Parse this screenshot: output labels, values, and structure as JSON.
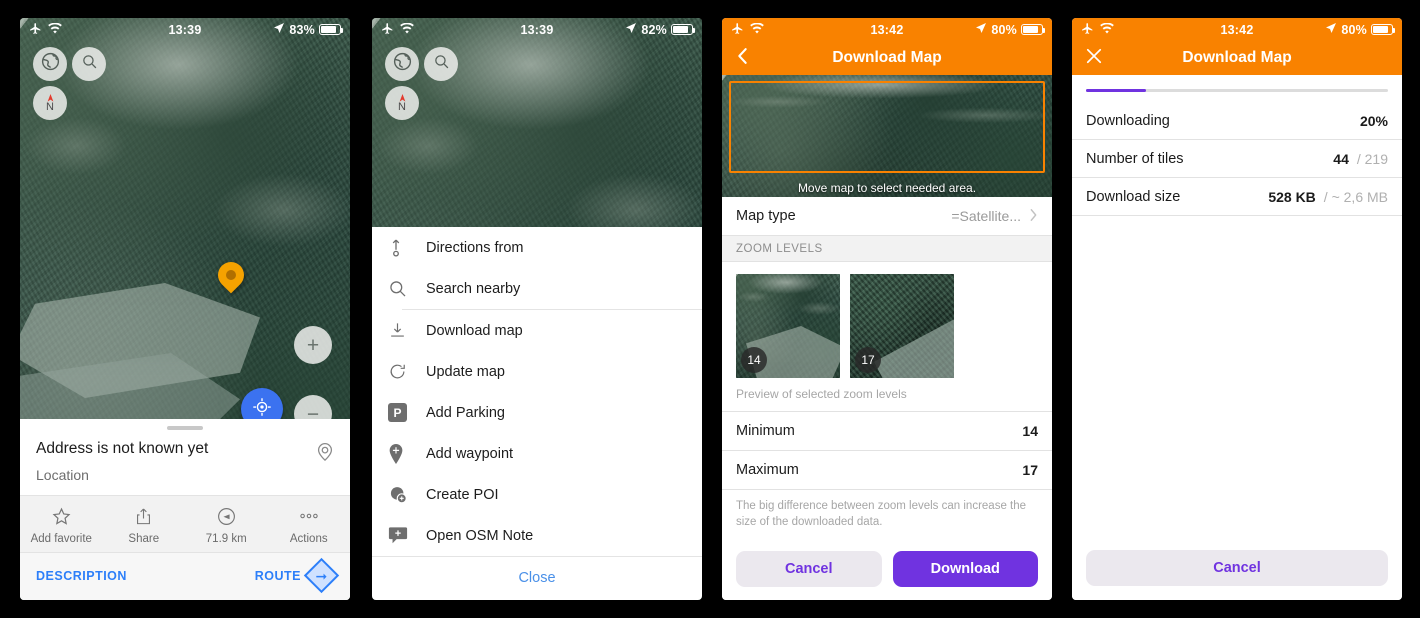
{
  "screens": {
    "map": {
      "status": {
        "time": "13:39",
        "battery": "83%",
        "airplane_icon": "airplane-icon",
        "wifi_icon": "wifi-icon",
        "location_icon": "location-arrow-icon"
      },
      "controls": {
        "layers_icon": "globe-layers-icon",
        "search_icon": "search-icon",
        "compass_label": "N",
        "zoom_in_label": "+",
        "zoom_out_label": "−",
        "locate_icon": "crosshair-icon",
        "marker_icon": "map-pin-icon"
      },
      "sheet": {
        "title": "Address is not known yet",
        "subtitle": "Location",
        "badge_icon": "target-pin-icon",
        "actions": [
          {
            "label": "Add favorite",
            "icon": "star-icon"
          },
          {
            "label": "Share",
            "icon": "share-icon"
          },
          {
            "label": "71.9 km",
            "icon": "direction-compass-icon"
          },
          {
            "label": "Actions",
            "icon": "more-dots-icon"
          }
        ],
        "description_label": "DESCRIPTION",
        "route_label": "ROUTE",
        "route_icon": "route-arrow-icon"
      }
    },
    "menu": {
      "status": {
        "time": "13:39",
        "battery": "82%"
      },
      "items": [
        {
          "label": "Directions from",
          "icon": "directions-from-icon"
        },
        {
          "label": "Search nearby",
          "icon": "search-icon"
        },
        {
          "label": "Download map",
          "icon": "download-icon"
        },
        {
          "label": "Update map",
          "icon": "refresh-icon"
        },
        {
          "label": "Add Parking",
          "icon": "parking-icon"
        },
        {
          "label": "Add waypoint",
          "icon": "waypoint-pin-icon"
        },
        {
          "label": "Create POI",
          "icon": "create-poi-icon"
        },
        {
          "label": "Open OSM Note",
          "icon": "osm-note-icon"
        }
      ],
      "close_label": "Close"
    },
    "download_setup": {
      "status": {
        "time": "13:42",
        "battery": "80%"
      },
      "nav": {
        "title": "Download Map",
        "back_icon": "chevron-left-icon"
      },
      "select_caption": "Move map to select needed area.",
      "map_type": {
        "label": "Map type",
        "value": "=Satellite...",
        "chevron_icon": "chevron-right-icon"
      },
      "zoom_section_title": "ZOOM LEVELS",
      "tiles": [
        {
          "badge": "14"
        },
        {
          "badge": "17"
        }
      ],
      "tiles_caption": "Preview of selected zoom levels",
      "minimum": {
        "label": "Minimum",
        "value": "14"
      },
      "maximum": {
        "label": "Maximum",
        "value": "17"
      },
      "hint": "The big difference between zoom levels can increase the size of the downloaded data.",
      "cancel_label": "Cancel",
      "download_label": "Download"
    },
    "download_progress": {
      "status": {
        "time": "13:42",
        "battery": "80%"
      },
      "nav": {
        "title": "Download Map",
        "close_icon": "close-x-icon"
      },
      "progress_percent": 20,
      "rows": [
        {
          "label": "Downloading",
          "value": "20%",
          "secondary": ""
        },
        {
          "label": "Number of tiles",
          "value": "44",
          "secondary": "/ 219"
        },
        {
          "label": "Download size",
          "value": "528 KB",
          "secondary": "/ ~ 2,6 MB"
        }
      ],
      "cancel_label": "Cancel"
    }
  },
  "colors": {
    "orange": "#f98200",
    "purple": "#7033e0",
    "blue": "#2d7ff9",
    "locate_blue": "#3b72f0",
    "pin_orange": "#f5a200"
  }
}
